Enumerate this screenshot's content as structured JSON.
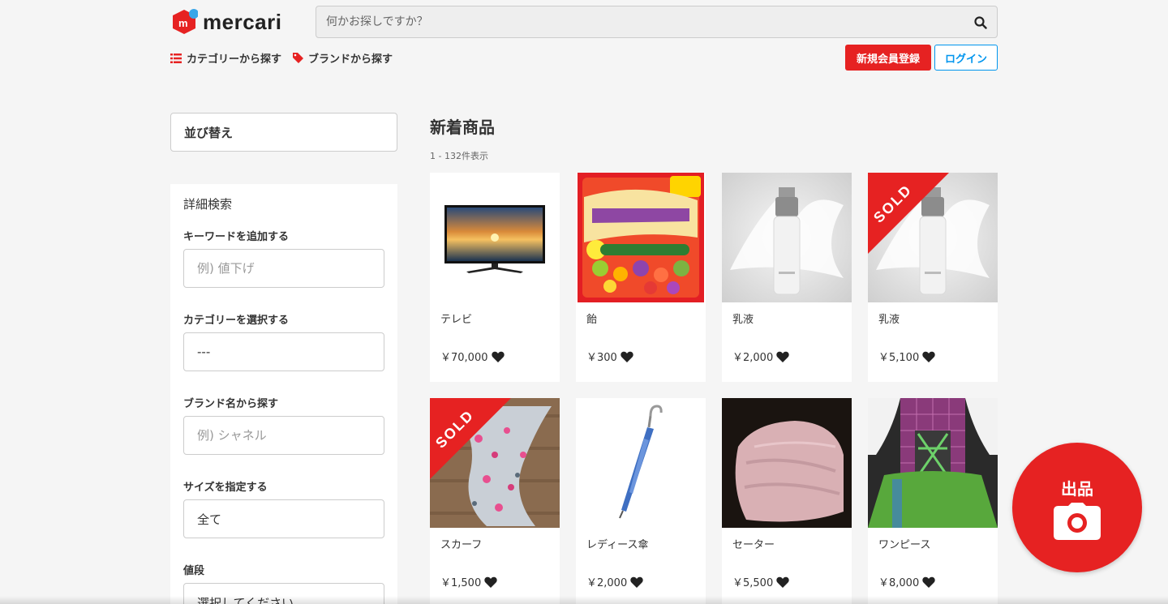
{
  "header": {
    "logo_text": "mercari",
    "search_placeholder": "何かお探しですか？",
    "nav": [
      {
        "label": "カテゴリーから探す",
        "icon": "list-icon"
      },
      {
        "label": "ブランドから探す",
        "icon": "tag-icon"
      }
    ],
    "register_label": "新規会員登録",
    "login_label": "ログイン"
  },
  "sidebar": {
    "sort_label": "並び替え",
    "filter_title": "詳細検索",
    "keyword": {
      "label": "キーワードを追加する",
      "placeholder": "例) 値下げ"
    },
    "category": {
      "label": "カテゴリーを選択する",
      "value": "---"
    },
    "brand": {
      "label": "ブランド名から探す",
      "placeholder": "例) シャネル"
    },
    "size": {
      "label": "サイズを指定する",
      "value": "全て"
    },
    "price": {
      "label": "値段",
      "value": "選択してください"
    }
  },
  "main": {
    "title": "新着商品",
    "count": "1 - 132件表示",
    "items": [
      {
        "name": "テレビ",
        "price": "￥70,000",
        "sold": false,
        "sold_text": ""
      },
      {
        "name": "飴",
        "price": "￥300",
        "sold": false,
        "sold_text": ""
      },
      {
        "name": "乳液",
        "price": "￥2,000",
        "sold": false,
        "sold_text": ""
      },
      {
        "name": "乳液",
        "price": "￥5,100",
        "sold": true,
        "sold_text": "SOLD"
      },
      {
        "name": "スカーフ",
        "price": "￥1,500",
        "sold": true,
        "sold_text": "SOLD"
      },
      {
        "name": "レディース傘",
        "price": "￥2,000",
        "sold": false,
        "sold_text": ""
      },
      {
        "name": "セーター",
        "price": "￥5,500",
        "sold": false,
        "sold_text": ""
      },
      {
        "name": "ワンピース",
        "price": "￥8,000",
        "sold": false,
        "sold_text": ""
      }
    ]
  },
  "fab": {
    "label": "出品",
    "icon": "camera-icon"
  },
  "colors": {
    "brand_red": "#e62222",
    "link_blue": "#0095ee",
    "background": "#f5f5f5"
  }
}
